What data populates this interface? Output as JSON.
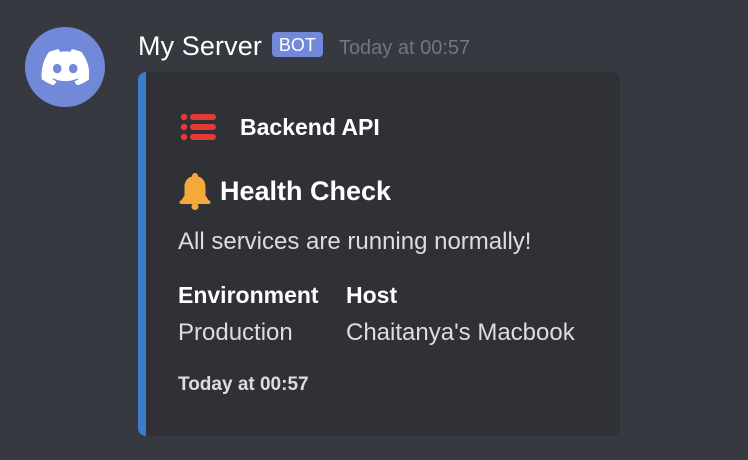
{
  "message": {
    "username": "My Server",
    "bot_tag": "BOT",
    "timestamp": "Today at 00:57",
    "avatar_icon": "discord-logo-icon"
  },
  "embed": {
    "accent_color": "#3d7bd0",
    "author": {
      "icon": "server-list-icon",
      "name": "Backend API"
    },
    "title_icon": "bell-icon",
    "title": "Health Check",
    "description": "All services are running normally!",
    "fields": [
      {
        "name": "Environment",
        "value": "Production"
      },
      {
        "name": "Host",
        "value": "Chaitanya's Macbook"
      }
    ],
    "footer": "Today at 00:57"
  },
  "colors": {
    "background": "#36393f",
    "embed_background": "#2f3136",
    "blurple": "#7289da",
    "server_icon_red": "#e53935",
    "bell_orange": "#f6a93b"
  }
}
